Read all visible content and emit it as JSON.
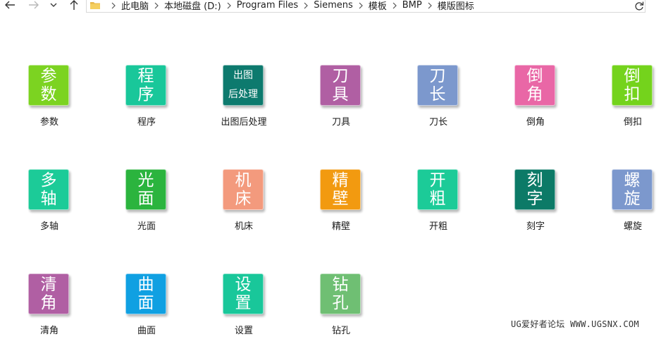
{
  "breadcrumb": [
    "此电脑",
    "本地磁盘 (D:)",
    "Program Files",
    "Siemens",
    "模板",
    "BMP",
    "模版图标"
  ],
  "icons": {
    "back": "arrow-left-icon",
    "forward": "arrow-right-icon",
    "recent": "chevron-down-icon",
    "up": "arrow-up-icon",
    "folder": "folder-icon",
    "refresh": "refresh-icon"
  },
  "files": [
    {
      "name": "参数",
      "lines": [
        "参",
        "数"
      ],
      "color": "#7cd321"
    },
    {
      "name": "程序",
      "lines": [
        "程",
        "序"
      ],
      "color": "#19c79a"
    },
    {
      "name": "出图后处理",
      "lines": [
        "出图",
        "后处理"
      ],
      "color": "#0d7a6e"
    },
    {
      "name": "刀具",
      "lines": [
        "刀",
        "具"
      ],
      "color": "#b05fa3"
    },
    {
      "name": "刀长",
      "lines": [
        "刀",
        "长"
      ],
      "color": "#7c98cd"
    },
    {
      "name": "倒角",
      "lines": [
        "倒",
        "角"
      ],
      "color": "#e967a6"
    },
    {
      "name": "倒扣",
      "lines": [
        "倒",
        "扣"
      ],
      "color": "#74d31c"
    },
    {
      "name": "多轴",
      "lines": [
        "多",
        "轴"
      ],
      "color": "#1ccb98"
    },
    {
      "name": "光面",
      "lines": [
        "光",
        "面"
      ],
      "color": "#2bb43e"
    },
    {
      "name": "机床",
      "lines": [
        "机",
        "床"
      ],
      "color": "#f39a7d"
    },
    {
      "name": "精壁",
      "lines": [
        "精",
        "壁"
      ],
      "color": "#f29a10"
    },
    {
      "name": "开粗",
      "lines": [
        "开",
        "粗"
      ],
      "color": "#1ccb98"
    },
    {
      "name": "刻字",
      "lines": [
        "刻",
        "字"
      ],
      "color": "#0c7a67"
    },
    {
      "name": "螺旋",
      "lines": [
        "螺",
        "旋"
      ],
      "color": "#7c98cd"
    },
    {
      "name": "清角",
      "lines": [
        "清",
        "角"
      ],
      "color": "#b05fa3"
    },
    {
      "name": "曲面",
      "lines": [
        "曲",
        "面"
      ],
      "color": "#10a0e2"
    },
    {
      "name": "设置",
      "lines": [
        "设",
        "置"
      ],
      "color": "#19c79a"
    },
    {
      "name": "钻孔",
      "lines": [
        "钻",
        "孔"
      ],
      "color": "#6fbf73"
    }
  ],
  "watermark": "UG爱好者论坛 WWW.UGSNX.COM"
}
